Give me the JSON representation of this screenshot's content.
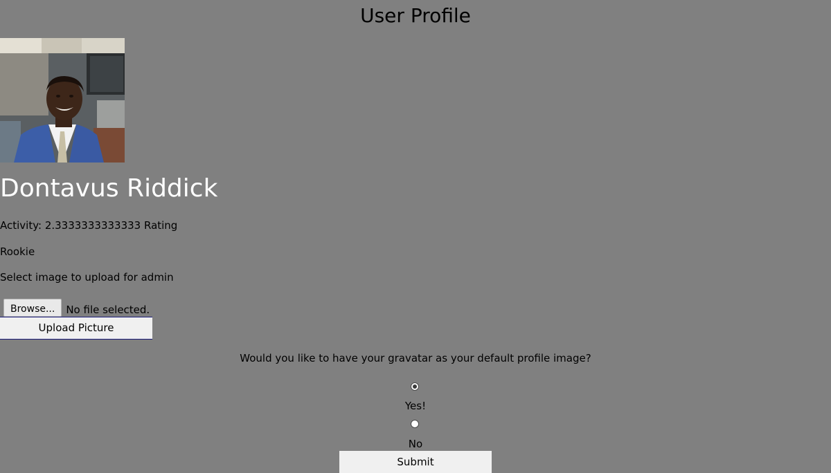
{
  "page": {
    "title": "User Profile"
  },
  "profile": {
    "name": "Dontavus Riddick",
    "activity_text": "Activity: 2.3333333333333 Rating",
    "rank": "Rookie"
  },
  "upload": {
    "label": "Select image to upload for admin",
    "browse_label": "Browse...",
    "file_status": "No file selected.",
    "submit_label": "Upload Picture"
  },
  "gravatar": {
    "question": "Would you like to have your gravatar as your default profile image?",
    "options": [
      {
        "label": "Yes!",
        "checked": true
      },
      {
        "label": "No",
        "checked": false
      }
    ],
    "submit_label": "Submit"
  },
  "colors": {
    "background": "#808080",
    "name_text": "#ffffff",
    "button_bg": "#f0f0f0"
  }
}
